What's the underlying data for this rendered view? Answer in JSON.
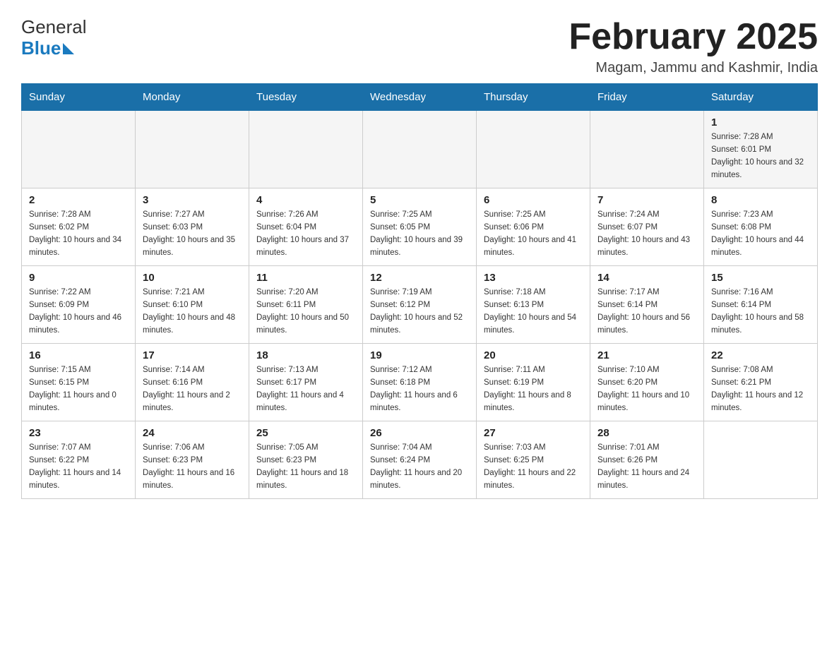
{
  "header": {
    "logo_general": "General",
    "logo_blue": "Blue",
    "month_title": "February 2025",
    "location": "Magam, Jammu and Kashmir, India"
  },
  "days_of_week": [
    "Sunday",
    "Monday",
    "Tuesday",
    "Wednesday",
    "Thursday",
    "Friday",
    "Saturday"
  ],
  "weeks": [
    {
      "days": [
        {
          "number": "",
          "sunrise": "",
          "sunset": "",
          "daylight": ""
        },
        {
          "number": "",
          "sunrise": "",
          "sunset": "",
          "daylight": ""
        },
        {
          "number": "",
          "sunrise": "",
          "sunset": "",
          "daylight": ""
        },
        {
          "number": "",
          "sunrise": "",
          "sunset": "",
          "daylight": ""
        },
        {
          "number": "",
          "sunrise": "",
          "sunset": "",
          "daylight": ""
        },
        {
          "number": "",
          "sunrise": "",
          "sunset": "",
          "daylight": ""
        },
        {
          "number": "1",
          "sunrise": "Sunrise: 7:28 AM",
          "sunset": "Sunset: 6:01 PM",
          "daylight": "Daylight: 10 hours and 32 minutes."
        }
      ]
    },
    {
      "days": [
        {
          "number": "2",
          "sunrise": "Sunrise: 7:28 AM",
          "sunset": "Sunset: 6:02 PM",
          "daylight": "Daylight: 10 hours and 34 minutes."
        },
        {
          "number": "3",
          "sunrise": "Sunrise: 7:27 AM",
          "sunset": "Sunset: 6:03 PM",
          "daylight": "Daylight: 10 hours and 35 minutes."
        },
        {
          "number": "4",
          "sunrise": "Sunrise: 7:26 AM",
          "sunset": "Sunset: 6:04 PM",
          "daylight": "Daylight: 10 hours and 37 minutes."
        },
        {
          "number": "5",
          "sunrise": "Sunrise: 7:25 AM",
          "sunset": "Sunset: 6:05 PM",
          "daylight": "Daylight: 10 hours and 39 minutes."
        },
        {
          "number": "6",
          "sunrise": "Sunrise: 7:25 AM",
          "sunset": "Sunset: 6:06 PM",
          "daylight": "Daylight: 10 hours and 41 minutes."
        },
        {
          "number": "7",
          "sunrise": "Sunrise: 7:24 AM",
          "sunset": "Sunset: 6:07 PM",
          "daylight": "Daylight: 10 hours and 43 minutes."
        },
        {
          "number": "8",
          "sunrise": "Sunrise: 7:23 AM",
          "sunset": "Sunset: 6:08 PM",
          "daylight": "Daylight: 10 hours and 44 minutes."
        }
      ]
    },
    {
      "days": [
        {
          "number": "9",
          "sunrise": "Sunrise: 7:22 AM",
          "sunset": "Sunset: 6:09 PM",
          "daylight": "Daylight: 10 hours and 46 minutes."
        },
        {
          "number": "10",
          "sunrise": "Sunrise: 7:21 AM",
          "sunset": "Sunset: 6:10 PM",
          "daylight": "Daylight: 10 hours and 48 minutes."
        },
        {
          "number": "11",
          "sunrise": "Sunrise: 7:20 AM",
          "sunset": "Sunset: 6:11 PM",
          "daylight": "Daylight: 10 hours and 50 minutes."
        },
        {
          "number": "12",
          "sunrise": "Sunrise: 7:19 AM",
          "sunset": "Sunset: 6:12 PM",
          "daylight": "Daylight: 10 hours and 52 minutes."
        },
        {
          "number": "13",
          "sunrise": "Sunrise: 7:18 AM",
          "sunset": "Sunset: 6:13 PM",
          "daylight": "Daylight: 10 hours and 54 minutes."
        },
        {
          "number": "14",
          "sunrise": "Sunrise: 7:17 AM",
          "sunset": "Sunset: 6:14 PM",
          "daylight": "Daylight: 10 hours and 56 minutes."
        },
        {
          "number": "15",
          "sunrise": "Sunrise: 7:16 AM",
          "sunset": "Sunset: 6:14 PM",
          "daylight": "Daylight: 10 hours and 58 minutes."
        }
      ]
    },
    {
      "days": [
        {
          "number": "16",
          "sunrise": "Sunrise: 7:15 AM",
          "sunset": "Sunset: 6:15 PM",
          "daylight": "Daylight: 11 hours and 0 minutes."
        },
        {
          "number": "17",
          "sunrise": "Sunrise: 7:14 AM",
          "sunset": "Sunset: 6:16 PM",
          "daylight": "Daylight: 11 hours and 2 minutes."
        },
        {
          "number": "18",
          "sunrise": "Sunrise: 7:13 AM",
          "sunset": "Sunset: 6:17 PM",
          "daylight": "Daylight: 11 hours and 4 minutes."
        },
        {
          "number": "19",
          "sunrise": "Sunrise: 7:12 AM",
          "sunset": "Sunset: 6:18 PM",
          "daylight": "Daylight: 11 hours and 6 minutes."
        },
        {
          "number": "20",
          "sunrise": "Sunrise: 7:11 AM",
          "sunset": "Sunset: 6:19 PM",
          "daylight": "Daylight: 11 hours and 8 minutes."
        },
        {
          "number": "21",
          "sunrise": "Sunrise: 7:10 AM",
          "sunset": "Sunset: 6:20 PM",
          "daylight": "Daylight: 11 hours and 10 minutes."
        },
        {
          "number": "22",
          "sunrise": "Sunrise: 7:08 AM",
          "sunset": "Sunset: 6:21 PM",
          "daylight": "Daylight: 11 hours and 12 minutes."
        }
      ]
    },
    {
      "days": [
        {
          "number": "23",
          "sunrise": "Sunrise: 7:07 AM",
          "sunset": "Sunset: 6:22 PM",
          "daylight": "Daylight: 11 hours and 14 minutes."
        },
        {
          "number": "24",
          "sunrise": "Sunrise: 7:06 AM",
          "sunset": "Sunset: 6:23 PM",
          "daylight": "Daylight: 11 hours and 16 minutes."
        },
        {
          "number": "25",
          "sunrise": "Sunrise: 7:05 AM",
          "sunset": "Sunset: 6:23 PM",
          "daylight": "Daylight: 11 hours and 18 minutes."
        },
        {
          "number": "26",
          "sunrise": "Sunrise: 7:04 AM",
          "sunset": "Sunset: 6:24 PM",
          "daylight": "Daylight: 11 hours and 20 minutes."
        },
        {
          "number": "27",
          "sunrise": "Sunrise: 7:03 AM",
          "sunset": "Sunset: 6:25 PM",
          "daylight": "Daylight: 11 hours and 22 minutes."
        },
        {
          "number": "28",
          "sunrise": "Sunrise: 7:01 AM",
          "sunset": "Sunset: 6:26 PM",
          "daylight": "Daylight: 11 hours and 24 minutes."
        },
        {
          "number": "",
          "sunrise": "",
          "sunset": "",
          "daylight": ""
        }
      ]
    }
  ]
}
